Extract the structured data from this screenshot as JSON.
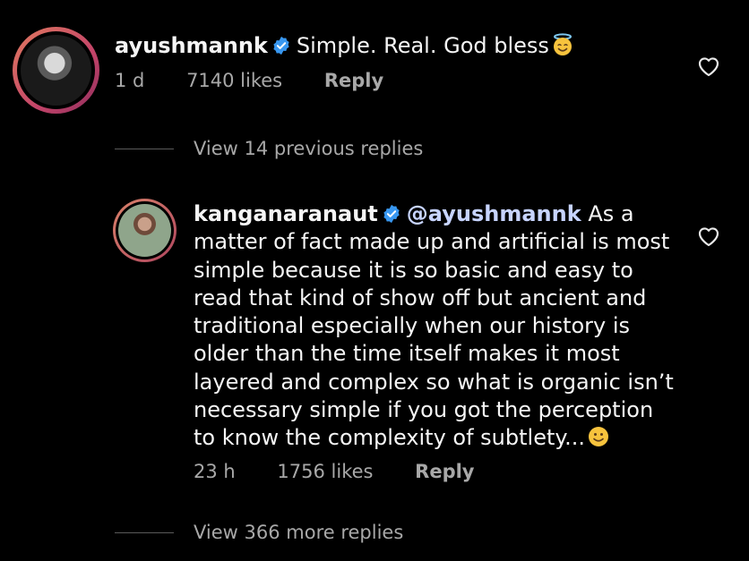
{
  "comment1": {
    "username": "ayushmannk",
    "text": "Simple. Real. God bless",
    "emoji_icon": "smiling-face-with-halo-emoji",
    "time": "1 d",
    "likes": "7140 likes",
    "reply_label": "Reply",
    "verified_icon": "verified-badge-icon",
    "heart_icon": "heart-outline-icon"
  },
  "view_previous": {
    "label": "View 14 previous replies"
  },
  "comment2": {
    "username": "kanganaranaut",
    "mention": "@ayushmannk",
    "text": "As a matter of fact made up and artificial is most simple because it is so basic and easy to read that kind of show off but ancient and traditional especially when our history is older than the time itself makes it most layered and complex so what is organic isn’t necessary simple if you got the perception to know the complexity of subtlety...",
    "emoji_icon": "slightly-smiling-face-emoji",
    "time": "23 h",
    "likes": "1756 likes",
    "reply_label": "Reply",
    "verified_icon": "verified-badge-icon",
    "heart_icon": "heart-outline-icon"
  },
  "view_more": {
    "label": "View 366 more replies"
  },
  "colors": {
    "background": "#000000",
    "text": "#f5f5f5",
    "muted": "#a8a8a8",
    "verified_blue": "#3897f0",
    "mention": "#c7d4ff"
  }
}
